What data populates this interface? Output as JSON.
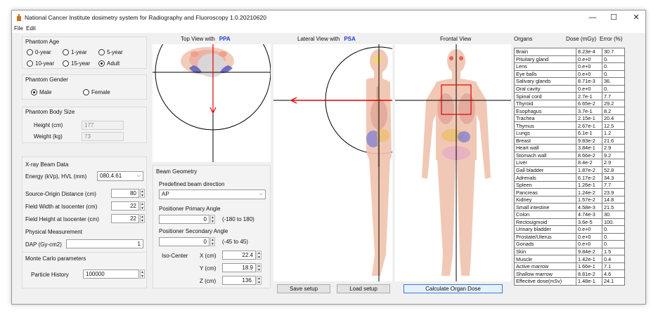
{
  "window": {
    "title": "National Cancer Institute dosimetry system for Radiography and Fluoroscopy 1.0.20210620",
    "minimize": "—",
    "maximize": "☐",
    "close": "✕"
  },
  "menu": {
    "file": "File",
    "edit": "Edit"
  },
  "phantom_age": {
    "label": "Phantom Age",
    "options": [
      "0-year",
      "1-year",
      "5-year",
      "10-year",
      "15-year",
      "Adult"
    ],
    "selected": "Adult"
  },
  "phantom_gender": {
    "label": "Phantom Gender",
    "options": [
      "Male",
      "Female"
    ],
    "selected": "Male"
  },
  "body_size": {
    "label": "Phantom Body Size",
    "height_label": "Height (cm)",
    "height_value": "177",
    "weight_label": "Weight (kg)",
    "weight_value": "73"
  },
  "beam_data": {
    "label": "X-ray Beam Data",
    "energy_label": "Energy (kVp), HVL (mm)",
    "energy_value": "080,4.61",
    "sod_label": "Source-Origin Distance (cm)",
    "sod_value": "80",
    "fw_label": "Field Width at Isocenter (cm)",
    "fw_value": "22",
    "fh_label": "Field Height at Isocenter (cm)",
    "fh_value": "22"
  },
  "measurement": {
    "label": "Physical Measurement",
    "dap_label": "DAP (Gy-cm2)",
    "dap_value": "1"
  },
  "monte_carlo": {
    "label": "Monte Carlo parameters",
    "history_label": "Particle History",
    "history_value": "100000"
  },
  "geometry": {
    "label": "Beam Geometry",
    "direction_label": "Predefined beam direction",
    "direction_value": "AP",
    "primary_label": "Positioner Primary Angle",
    "primary_value": "0",
    "primary_range": "(-180 to 180)",
    "secondary_label": "Positioner Secondary Angle",
    "secondary_value": "0",
    "secondary_range": "(-45 to 45)",
    "iso_label": "Iso-Center",
    "x_label": "X (cm)",
    "x_value": "22.4",
    "y_label": "Y (cm)",
    "y_value": "18.9",
    "z_label": "Z (cm)",
    "z_value": "136."
  },
  "views": {
    "top_label": "Top View with",
    "top_tag": "PPA",
    "lateral_label": "Lateral View with",
    "lateral_tag": "PSA",
    "frontal_label": "Frontal View"
  },
  "buttons": {
    "save": "Save setup",
    "load": "Load setup",
    "calc": "Calculate Organ Dose"
  },
  "organs": {
    "col_organs": "Organs",
    "col_dose": "Dose (mGy)",
    "col_error": "Error (%)",
    "rows": [
      [
        "Brain",
        "8.23e-4",
        "30.7"
      ],
      [
        "Pituitary gland",
        "0.e+0",
        "0."
      ],
      [
        "Lens",
        "0.e+0",
        "0."
      ],
      [
        "Eye balls",
        "0.e+0",
        "0."
      ],
      [
        "Salivary glands",
        "8.71e-3",
        "36."
      ],
      [
        "Oral cavity",
        "0.e+0",
        "0."
      ],
      [
        "Spinal cord",
        "2.7e-1",
        "7.7"
      ],
      [
        "Thyroid",
        "6.65e-2",
        "29.2"
      ],
      [
        "Esophagus",
        "3.7e-1",
        "8.2"
      ],
      [
        "Trachea",
        "2.15e-1",
        "20.4"
      ],
      [
        "Thymus",
        "2.67e-1",
        "12.5"
      ],
      [
        "Lungs",
        "6.1e-1",
        "1.2"
      ],
      [
        "Breast",
        "9.83e-2",
        "21.6"
      ],
      [
        "Heart wall",
        "3.84e-1",
        "2.9"
      ],
      [
        "Stomach wall",
        "8.66e-2",
        "9.2"
      ],
      [
        "Liver",
        "8.4e-2",
        "2.9"
      ],
      [
        "Gall bladder",
        "1.87e-2",
        "52.8"
      ],
      [
        "Adrenals",
        "6.17e-2",
        "34.3"
      ],
      [
        "Spleen",
        "1.26e-1",
        "7.7"
      ],
      [
        "Pancreas",
        "1.24e-2",
        "23.9"
      ],
      [
        "Kidney",
        "1.57e-2",
        "14.8"
      ],
      [
        "Small intestine",
        "4.58e-3",
        "21.5"
      ],
      [
        "Colon",
        "4.74e-3",
        "30."
      ],
      [
        "Rectosigmoid",
        "3.6e-5",
        "100."
      ],
      [
        "Urinary bladder",
        "0.e+0",
        "0."
      ],
      [
        "Prostate/Uterus",
        "0.e+0",
        "0."
      ],
      [
        "Gonads",
        "0.e+0",
        "0."
      ],
      [
        "Skin",
        "9.84e-2",
        "1.5"
      ],
      [
        "Muscle",
        "1.42e-1",
        "0.4"
      ],
      [
        "Active marrow",
        "1.66e-1",
        "7.1"
      ],
      [
        "Shallow marrow",
        "8.81e-2",
        "4.6"
      ],
      [
        "Effective dose(mSv)",
        "1.48e-1",
        "24.1"
      ]
    ]
  }
}
